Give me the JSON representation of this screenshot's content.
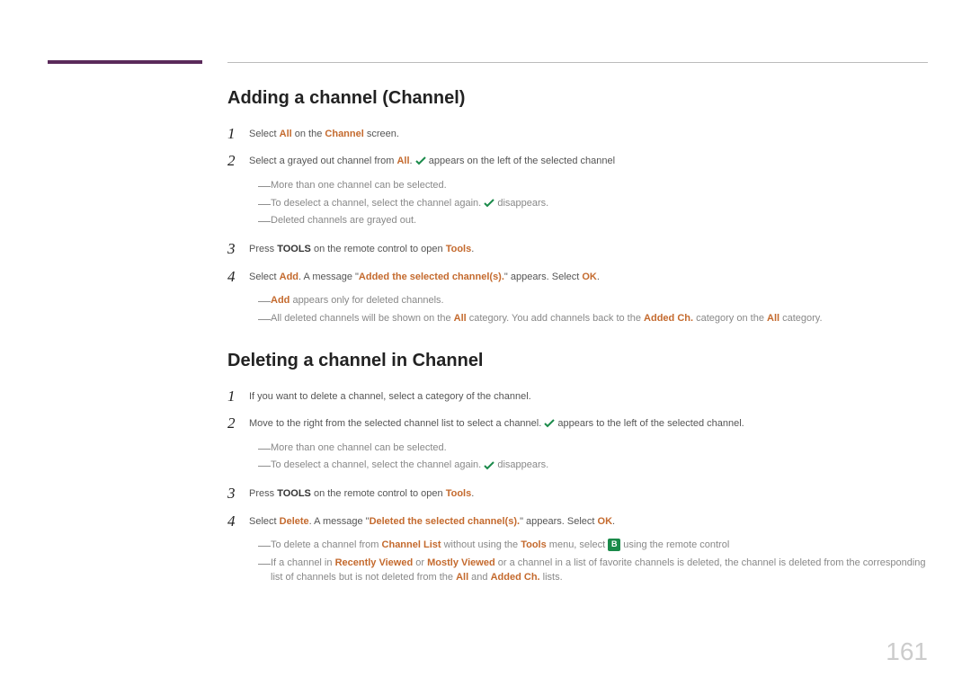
{
  "page_number": "161",
  "sections": [
    {
      "heading": "Adding a channel (Channel)",
      "steps": [
        {
          "num": "1",
          "frags": [
            {
              "t": "Select "
            },
            {
              "t": "All",
              "cls": "kw-r"
            },
            {
              "t": " on the "
            },
            {
              "t": "Channel",
              "cls": "kw-r"
            },
            {
              "t": " screen."
            }
          ],
          "notes": []
        },
        {
          "num": "2",
          "frags": [
            {
              "t": "Select a grayed out channel from "
            },
            {
              "t": "All",
              "cls": "kw-r"
            },
            {
              "t": ". "
            },
            {
              "icon": "check"
            },
            {
              "t": " appears on the left of the selected channel"
            }
          ],
          "notes": [
            {
              "frags": [
                {
                  "t": "More than one channel can be selected."
                }
              ]
            },
            {
              "frags": [
                {
                  "t": "To deselect a channel, select the channel again. "
                },
                {
                  "icon": "check"
                },
                {
                  "t": " disappears."
                }
              ]
            },
            {
              "frags": [
                {
                  "t": "Deleted channels are grayed out."
                }
              ]
            }
          ]
        },
        {
          "num": "3",
          "frags": [
            {
              "t": "Press "
            },
            {
              "t": "TOOLS",
              "cls": "kw-b"
            },
            {
              "t": " on the remote control to open "
            },
            {
              "t": "Tools",
              "cls": "kw-r"
            },
            {
              "t": "."
            }
          ],
          "notes": []
        },
        {
          "num": "4",
          "frags": [
            {
              "t": "Select "
            },
            {
              "t": "Add",
              "cls": "kw-r"
            },
            {
              "t": ". A message \""
            },
            {
              "t": "Added the selected channel(s).",
              "cls": "kw-r"
            },
            {
              "t": "\" appears. Select "
            },
            {
              "t": "OK",
              "cls": "kw-r"
            },
            {
              "t": "."
            }
          ],
          "notes": [
            {
              "frags": [
                {
                  "t": "Add",
                  "cls": "kw-r"
                },
                {
                  "t": " appears only for deleted channels."
                }
              ]
            },
            {
              "frags": [
                {
                  "t": "All deleted channels will be shown on the "
                },
                {
                  "t": "All",
                  "cls": "kw-r"
                },
                {
                  "t": " category. You add channels back to the "
                },
                {
                  "t": "Added Ch.",
                  "cls": "kw-r"
                },
                {
                  "t": " category on the "
                },
                {
                  "t": "All",
                  "cls": "kw-r"
                },
                {
                  "t": " category."
                }
              ]
            }
          ]
        }
      ]
    },
    {
      "heading": "Deleting a channel in Channel",
      "steps": [
        {
          "num": "1",
          "frags": [
            {
              "t": "If you want to delete a channel, select a category of the channel."
            }
          ],
          "notes": []
        },
        {
          "num": "2",
          "frags": [
            {
              "t": "Move to the right from the selected channel list to select a channel. "
            },
            {
              "icon": "check"
            },
            {
              "t": " appears to the left of the selected channel."
            }
          ],
          "notes": [
            {
              "frags": [
                {
                  "t": "More than one channel can be selected."
                }
              ]
            },
            {
              "frags": [
                {
                  "t": "To deselect a channel, select the channel again. "
                },
                {
                  "icon": "check"
                },
                {
                  "t": " disappears."
                }
              ]
            }
          ]
        },
        {
          "num": "3",
          "frags": [
            {
              "t": "Press "
            },
            {
              "t": "TOOLS",
              "cls": "kw-b"
            },
            {
              "t": " on the remote control to open "
            },
            {
              "t": "Tools",
              "cls": "kw-r"
            },
            {
              "t": "."
            }
          ],
          "notes": []
        },
        {
          "num": "4",
          "frags": [
            {
              "t": "Select "
            },
            {
              "t": "Delete",
              "cls": "kw-r"
            },
            {
              "t": ". A message \""
            },
            {
              "t": "Deleted the selected channel(s).",
              "cls": "kw-r"
            },
            {
              "t": "\" appears. Select "
            },
            {
              "t": "OK",
              "cls": "kw-r"
            },
            {
              "t": "."
            }
          ],
          "notes": [
            {
              "frags": [
                {
                  "t": "To delete a channel from "
                },
                {
                  "t": "Channel List",
                  "cls": "kw-r"
                },
                {
                  "t": " without using the "
                },
                {
                  "t": "Tools",
                  "cls": "kw-r"
                },
                {
                  "t": " menu, select "
                },
                {
                  "icon": "b"
                },
                {
                  "t": " using the remote control"
                }
              ]
            },
            {
              "frags": [
                {
                  "t": "If a channel in "
                },
                {
                  "t": "Recently Viewed",
                  "cls": "kw-r"
                },
                {
                  "t": " or "
                },
                {
                  "t": "Mostly Viewed",
                  "cls": "kw-r"
                },
                {
                  "t": " or a channel in a list of favorite channels is deleted, the channel is deleted from the corresponding list of channels but is not deleted from the "
                },
                {
                  "t": "All",
                  "cls": "kw-r"
                },
                {
                  "t": " and "
                },
                {
                  "t": "Added Ch.",
                  "cls": "kw-r"
                },
                {
                  "t": " lists."
                }
              ]
            }
          ]
        }
      ]
    }
  ]
}
